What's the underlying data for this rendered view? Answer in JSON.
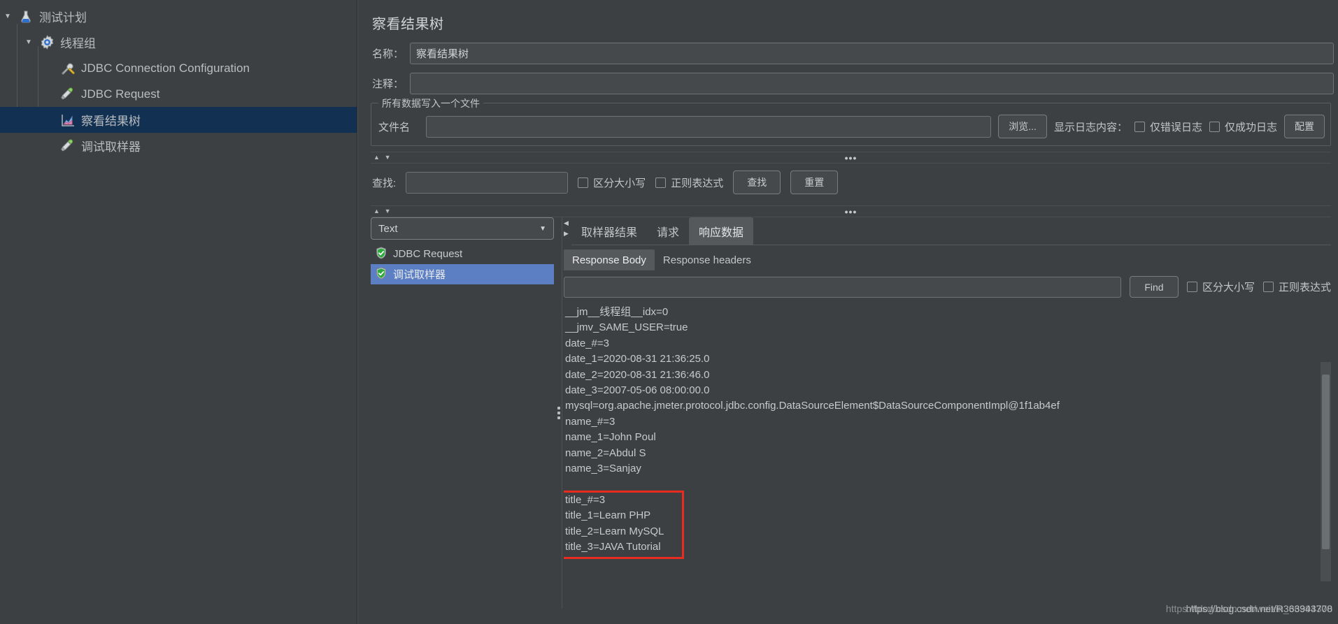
{
  "app": {
    "theme_bg": "#3c4043",
    "accent_selected": "#123152",
    "list_selected": "#5c7fc4",
    "highlight": "#e82c20"
  },
  "tree": {
    "items": [
      {
        "label": "测试计划",
        "icon": "flask-icon",
        "depth": 0,
        "expanded": true,
        "selected": false
      },
      {
        "label": "线程组",
        "icon": "gear-icon",
        "depth": 1,
        "expanded": true,
        "selected": false
      },
      {
        "label": "JDBC Connection Configuration",
        "icon": "wrench-screwdriver-icon",
        "depth": 2,
        "expanded": null,
        "selected": false
      },
      {
        "label": "JDBC Request",
        "icon": "pipette-icon",
        "depth": 2,
        "expanded": null,
        "selected": false
      },
      {
        "label": "察看结果树",
        "icon": "chart-icon",
        "depth": 2,
        "expanded": null,
        "selected": true
      },
      {
        "label": "调试取样器",
        "icon": "pipette-icon",
        "depth": 2,
        "expanded": null,
        "selected": false
      }
    ]
  },
  "panel": {
    "title": "察看结果树",
    "name_label": "名称：",
    "name_value": "察看结果树",
    "comment_label": "注释：",
    "comment_value": "",
    "comment_placeholder": ""
  },
  "filegroup": {
    "legend": "所有数据写入一个文件",
    "filename_label": "文件名",
    "filename_value": "",
    "browse_label": "浏览...",
    "log_display_label": "显示日志内容：",
    "errors_only_label": "仅错误日志",
    "success_only_label": "仅成功日志",
    "configure_label": "配置"
  },
  "splitbar": {
    "dots": "•••",
    "up_arrow": "▲",
    "down_arrow": "▼"
  },
  "search": {
    "label": "查找:",
    "value": "",
    "case_sensitive_label": "区分大小写",
    "regex_label": "正则表达式",
    "find_button": "查找",
    "reset_button": "重置"
  },
  "results": {
    "renderer_selected": "Text",
    "renderer_caret": "▼",
    "items": [
      {
        "label": "JDBC Request",
        "status": "success",
        "selected": false
      },
      {
        "label": "调试取样器",
        "status": "success",
        "selected": true
      }
    ]
  },
  "detail": {
    "tabs": [
      {
        "label": "取样器结果",
        "active": false
      },
      {
        "label": "请求",
        "active": false
      },
      {
        "label": "响应数据",
        "active": true
      }
    ],
    "subtabs": [
      {
        "label": "Response Body",
        "active": true
      },
      {
        "label": "Response headers",
        "active": false
      }
    ],
    "find": {
      "value": "",
      "button": "Find",
      "case_sensitive_label": "区分大小写",
      "regex_label": "正则表达式"
    },
    "body_lines": [
      "__jm__线程组__idx=0",
      "__jmv_SAME_USER=true",
      "date_#=3",
      "date_1=2020-08-31 21:36:25.0",
      "date_2=2020-08-31 21:36:46.0",
      "date_3=2007-05-06 08:00:00.0",
      "mysql=org.apache.jmeter.protocol.jdbc.config.DataSourceElement$DataSourceComponentImpl@1f1ab4ef",
      "name_#=3",
      "name_1=John Poul",
      "name_2=Abdul S",
      "name_3=Sanjay",
      "",
      "title_#=3",
      "title_1=Learn PHP",
      "title_2=Learn MySQL",
      "title_3=JAVA Tutorial"
    ]
  },
  "watermark": {
    "text_back": "https://blog.csdn.net/weixin_36394370",
    "text_front": "https://blog.csdn.net/R363943708"
  }
}
